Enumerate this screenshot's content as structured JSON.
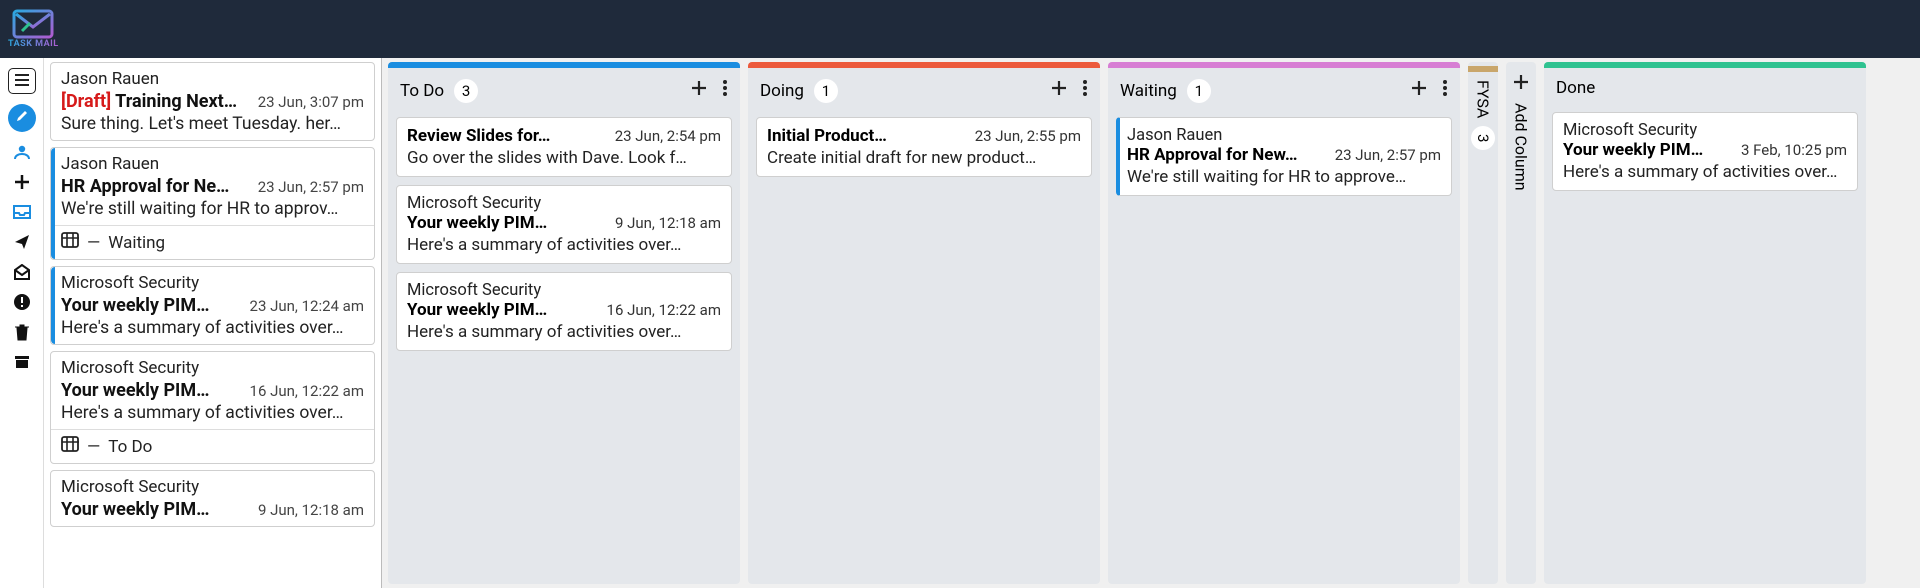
{
  "app": {
    "name": "TASK MAIL"
  },
  "emails": [
    {
      "from": "Jason Rauen",
      "draft": true,
      "draft_label": "[Draft]",
      "subject": "Training Next…",
      "time": "23 Jun, 3:07 pm",
      "preview": "Sure thing. Let's meet Tuesday. her…",
      "accent": false,
      "tag": null
    },
    {
      "from": "Jason Rauen",
      "draft": false,
      "subject": "HR Approval for Ne…",
      "time": "23 Jun, 2:57 pm",
      "preview": "We're still waiting for HR to approv…",
      "accent": true,
      "tag": "Waiting"
    },
    {
      "from": "Microsoft Security",
      "draft": false,
      "subject": "Your weekly PIM…",
      "time": "23 Jun, 12:24 am",
      "preview": "Here's a summary of activities over…",
      "accent": true,
      "tag": null
    },
    {
      "from": "Microsoft Security",
      "draft": false,
      "subject": "Your weekly PIM…",
      "time": "16 Jun, 12:22 am",
      "preview": "Here's a summary of activities over…",
      "accent": false,
      "tag": "To Do"
    },
    {
      "from": "Microsoft Security",
      "draft": false,
      "subject": "Your weekly PIM…",
      "time": "9 Jun, 12:18 am",
      "preview": "",
      "accent": false,
      "tag": null
    }
  ],
  "tag_separator": "—",
  "columns": {
    "todo": {
      "title": "To Do",
      "count": "3",
      "color": "#1a8de0",
      "cards": [
        {
          "from": null,
          "subject": "Review Slides for…",
          "time": "23 Jun, 2:54 pm",
          "preview": "Go over the slides with Dave. Look f…",
          "accent": false
        },
        {
          "from": "Microsoft Security",
          "subject": "Your weekly PIM…",
          "time": "9 Jun, 12:18 am",
          "preview": "Here's a summary of activities over…",
          "accent": false
        },
        {
          "from": "Microsoft Security",
          "subject": "Your weekly PIM…",
          "time": "16 Jun, 12:22 am",
          "preview": "Here's a summary of activities over…",
          "accent": false
        }
      ]
    },
    "doing": {
      "title": "Doing",
      "count": "1",
      "color": "#ec5a3c",
      "cards": [
        {
          "from": null,
          "subject": "Initial Product…",
          "time": "23 Jun, 2:55 pm",
          "preview": "Create initial draft for new product…",
          "accent": false
        }
      ]
    },
    "waiting": {
      "title": "Waiting",
      "count": "1",
      "color": "#d77ed4",
      "cards": [
        {
          "from": "Jason Rauen",
          "subject": "HR Approval for New…",
          "time": "23 Jun, 2:57 pm",
          "preview": "We're still waiting for HR to approve…",
          "accent": true
        }
      ]
    },
    "fysa": {
      "title": "FYSA",
      "count": "3",
      "color": "#c9a66b"
    },
    "done": {
      "title": "Done",
      "color": "#2fc290",
      "cards": [
        {
          "from": "Microsoft Security",
          "subject": "Your weekly PIM…",
          "time": "3 Feb, 10:25 pm",
          "preview": "Here's a summary of activities over…",
          "accent": false
        }
      ]
    }
  },
  "add_column_label": "Add Column"
}
